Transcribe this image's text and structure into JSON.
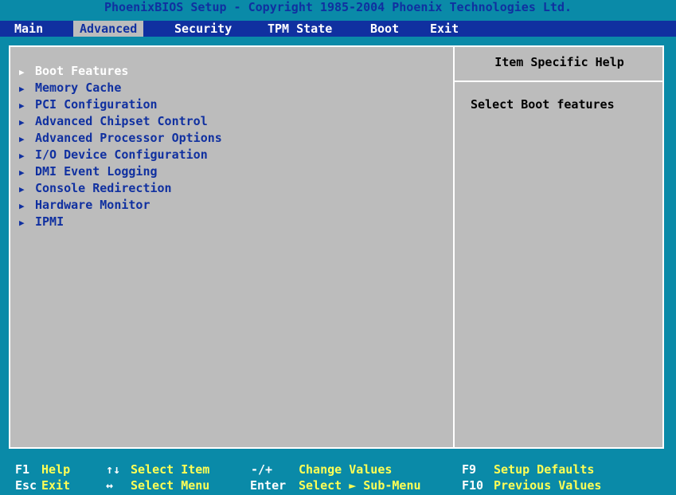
{
  "title": "PhoenixBIOS Setup - Copyright 1985-2004 Phoenix Technologies Ltd.",
  "tabs": [
    {
      "label": "Main"
    },
    {
      "label": "Advanced"
    },
    {
      "label": "Security"
    },
    {
      "label": "TPM State"
    },
    {
      "label": "Boot"
    },
    {
      "label": "Exit"
    }
  ],
  "active_tab": "Advanced",
  "menu": {
    "items": [
      {
        "label": "Boot Features",
        "selected": true
      },
      {
        "label": "Memory Cache"
      },
      {
        "label": "PCI Configuration"
      },
      {
        "label": "Advanced Chipset Control"
      },
      {
        "label": "Advanced Processor Options"
      },
      {
        "label": "I/O Device Configuration"
      },
      {
        "label": "DMI Event Logging"
      },
      {
        "label": "Console Redirection"
      },
      {
        "label": "Hardware Monitor"
      },
      {
        "label": "IPMI"
      }
    ],
    "submenu_marker_icon": "right-triangle-icon"
  },
  "help": {
    "header": "Item Specific Help",
    "text": "Select Boot features"
  },
  "footer": {
    "row1": [
      {
        "key": "F1",
        "desc": "Help"
      },
      {
        "key": "↑↓",
        "desc": "Select Item"
      },
      {
        "key": "-/+",
        "desc": "Change Values"
      },
      {
        "key": "F9",
        "desc": "Setup Defaults"
      }
    ],
    "row2": [
      {
        "key": "Esc",
        "desc": "Exit"
      },
      {
        "key": "↔",
        "desc": "Select Menu"
      },
      {
        "key": "Enter",
        "desc": "Select ► Sub-Menu"
      },
      {
        "key": "F10",
        "desc": "Previous Values"
      }
    ]
  },
  "colors": {
    "background": "#0a8aa8",
    "menubar": "#1030a0",
    "active_tab_bg": "#bcbcbc",
    "panel": "#bcbcbc",
    "title_text": "#1030a0",
    "menu_text": "#1030a0",
    "selected_text": "#ffffff",
    "tab_text": "#ffffff",
    "active_tab_text": "#1030a0",
    "help_text": "#000000",
    "footer_key": "#ffffff",
    "footer_desc": "#ffff55"
  }
}
